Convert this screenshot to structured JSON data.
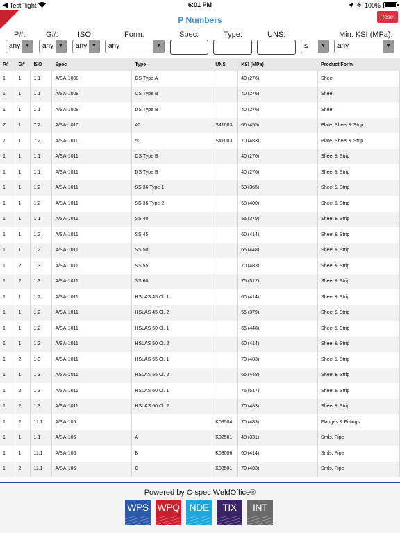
{
  "status_bar": {
    "back_app": "TestFlight",
    "time": "6:01 PM",
    "battery_pct": "100%",
    "battery_level": 1.0
  },
  "header": {
    "title": "P Numbers",
    "reset_label": "Reset"
  },
  "filters": {
    "p_label": "P#:",
    "p_value": "any",
    "g_label": "G#:",
    "g_value": "any",
    "iso_label": "ISO:",
    "iso_value": "any",
    "form_label": "Form:",
    "form_value": "any",
    "spec_label": "Spec:",
    "spec_value": "",
    "type_label": "Type:",
    "type_value": "",
    "uns_label": "UNS:",
    "uns_value": "",
    "ksi_op_value": "≤",
    "ksi_label": "Min. KSI (MPa):",
    "ksi_value": "any"
  },
  "table": {
    "columns": [
      "P#",
      "G#",
      "ISO",
      "Spec",
      "Type",
      "UNS",
      "KSI (MPa)",
      "Product Form"
    ],
    "rows": [
      [
        "1",
        "1",
        "1.1",
        "A/SA-1008",
        "CS Type A",
        "",
        "40 (276)",
        "Sheet"
      ],
      [
        "1",
        "1",
        "1.1",
        "A/SA-1008",
        "CS Type B",
        "",
        "40 (276)",
        "Sheet"
      ],
      [
        "1",
        "1",
        "1.1",
        "A/SA-1008",
        "DS Type B",
        "",
        "40 (276)",
        "Sheet"
      ],
      [
        "7",
        "1",
        "7.2",
        "A/SA-1010",
        "40",
        "S41003",
        "66 (455)",
        "Plate, Sheet & Strip"
      ],
      [
        "7",
        "1",
        "7.2",
        "A/SA-1010",
        "50",
        "S41003",
        "70 (483)",
        "Plate, Sheet & Strip"
      ],
      [
        "1",
        "1",
        "1.1",
        "A/SA-1011",
        "CS Type B",
        "",
        "40 (276)",
        "Sheet & Strip"
      ],
      [
        "1",
        "1",
        "1.1",
        "A/SA-1011",
        "DS Type B",
        "",
        "40 (276)",
        "Sheet & Strip"
      ],
      [
        "1",
        "1",
        "1.2",
        "A/SA-1011",
        "SS 36 Type 1",
        "",
        "53 (365)",
        "Sheet & Strip"
      ],
      [
        "1",
        "1",
        "1.2",
        "A/SA-1011",
        "SS 36 Type 2",
        "",
        "58 (400)",
        "Sheet & Strip"
      ],
      [
        "1",
        "1",
        "1.1",
        "A/SA-1011",
        "SS 40",
        "",
        "55 (379)",
        "Sheet & Strip"
      ],
      [
        "1",
        "1",
        "1.2",
        "A/SA-1011",
        "SS 45",
        "",
        "60 (414)",
        "Sheet & Strip"
      ],
      [
        "1",
        "1",
        "1.2",
        "A/SA-1011",
        "SS 50",
        "",
        "65 (448)",
        "Sheet & Strip"
      ],
      [
        "1",
        "2",
        "1.3",
        "A/SA-1011",
        "SS 55",
        "",
        "70 (483)",
        "Sheet & Strip"
      ],
      [
        "1",
        "2",
        "1.3",
        "A/SA-1011",
        "SS 60",
        "",
        "75 (517)",
        "Sheet & Strip"
      ],
      [
        "1",
        "1",
        "1.2",
        "A/SA-1011",
        "HSLAS 45 Cl. 1",
        "",
        "60 (414)",
        "Sheet & Strip"
      ],
      [
        "1",
        "1",
        "1.2",
        "A/SA-1011",
        "HSLAS 45 Cl. 2",
        "",
        "55 (379)",
        "Sheet & Strip"
      ],
      [
        "1",
        "1",
        "1.2",
        "A/SA-1011",
        "HSLAS 50 Cl. 1",
        "",
        "65 (448)",
        "Sheet & Strip"
      ],
      [
        "1",
        "1",
        "1.2",
        "A/SA-1011",
        "HSLAS 50 Cl. 2",
        "",
        "60 (414)",
        "Sheet & Strip"
      ],
      [
        "1",
        "2",
        "1.3",
        "A/SA-1011",
        "HSLAS 55 Cl. 1",
        "",
        "70 (483)",
        "Sheet & Strip"
      ],
      [
        "1",
        "1",
        "1.3",
        "A/SA-1011",
        "HSLAS 55 Cl. 2",
        "",
        "65 (448)",
        "Sheet & Strip"
      ],
      [
        "1",
        "2",
        "1.3",
        "A/SA-1011",
        "HSLAS 60 Cl. 1",
        "",
        "75 (517)",
        "Sheet & Strip"
      ],
      [
        "1",
        "2",
        "1.3",
        "A/SA-1011",
        "HSLAS 60 Cl. 2",
        "",
        "70 (483)",
        "Sheet & Strip"
      ],
      [
        "1",
        "2",
        "11.1",
        "A/SA-105",
        "",
        "K03504",
        "70 (483)",
        "Flanges & Fittings"
      ],
      [
        "1",
        "1",
        "1.1",
        "A/SA-106",
        "A",
        "K02501",
        "48 (331)",
        "Smls. Pipe"
      ],
      [
        "1",
        "1",
        "11.1",
        "A/SA-106",
        "B",
        "K03006",
        "60 (414)",
        "Smls. Pipe"
      ],
      [
        "1",
        "2",
        "11.1",
        "A/SA-106",
        "C",
        "K03501",
        "70 (483)",
        "Smls. Pipe"
      ]
    ]
  },
  "footer": {
    "powered_by": "Powered by C-spec WeldOffice®",
    "products": [
      {
        "label": "WPS",
        "color": "#2a5aa8"
      },
      {
        "label": "WPQ",
        "color": "#c8202c"
      },
      {
        "label": "NDE",
        "color": "#1fa6dc"
      },
      {
        "label": "TIX",
        "color": "#3b2368"
      },
      {
        "label": "INT",
        "color": "#6a6a6a"
      }
    ]
  },
  "colors": {
    "accent": "#3a8fd6",
    "reset": "#d9333f",
    "rule": "#2f3fa8"
  }
}
